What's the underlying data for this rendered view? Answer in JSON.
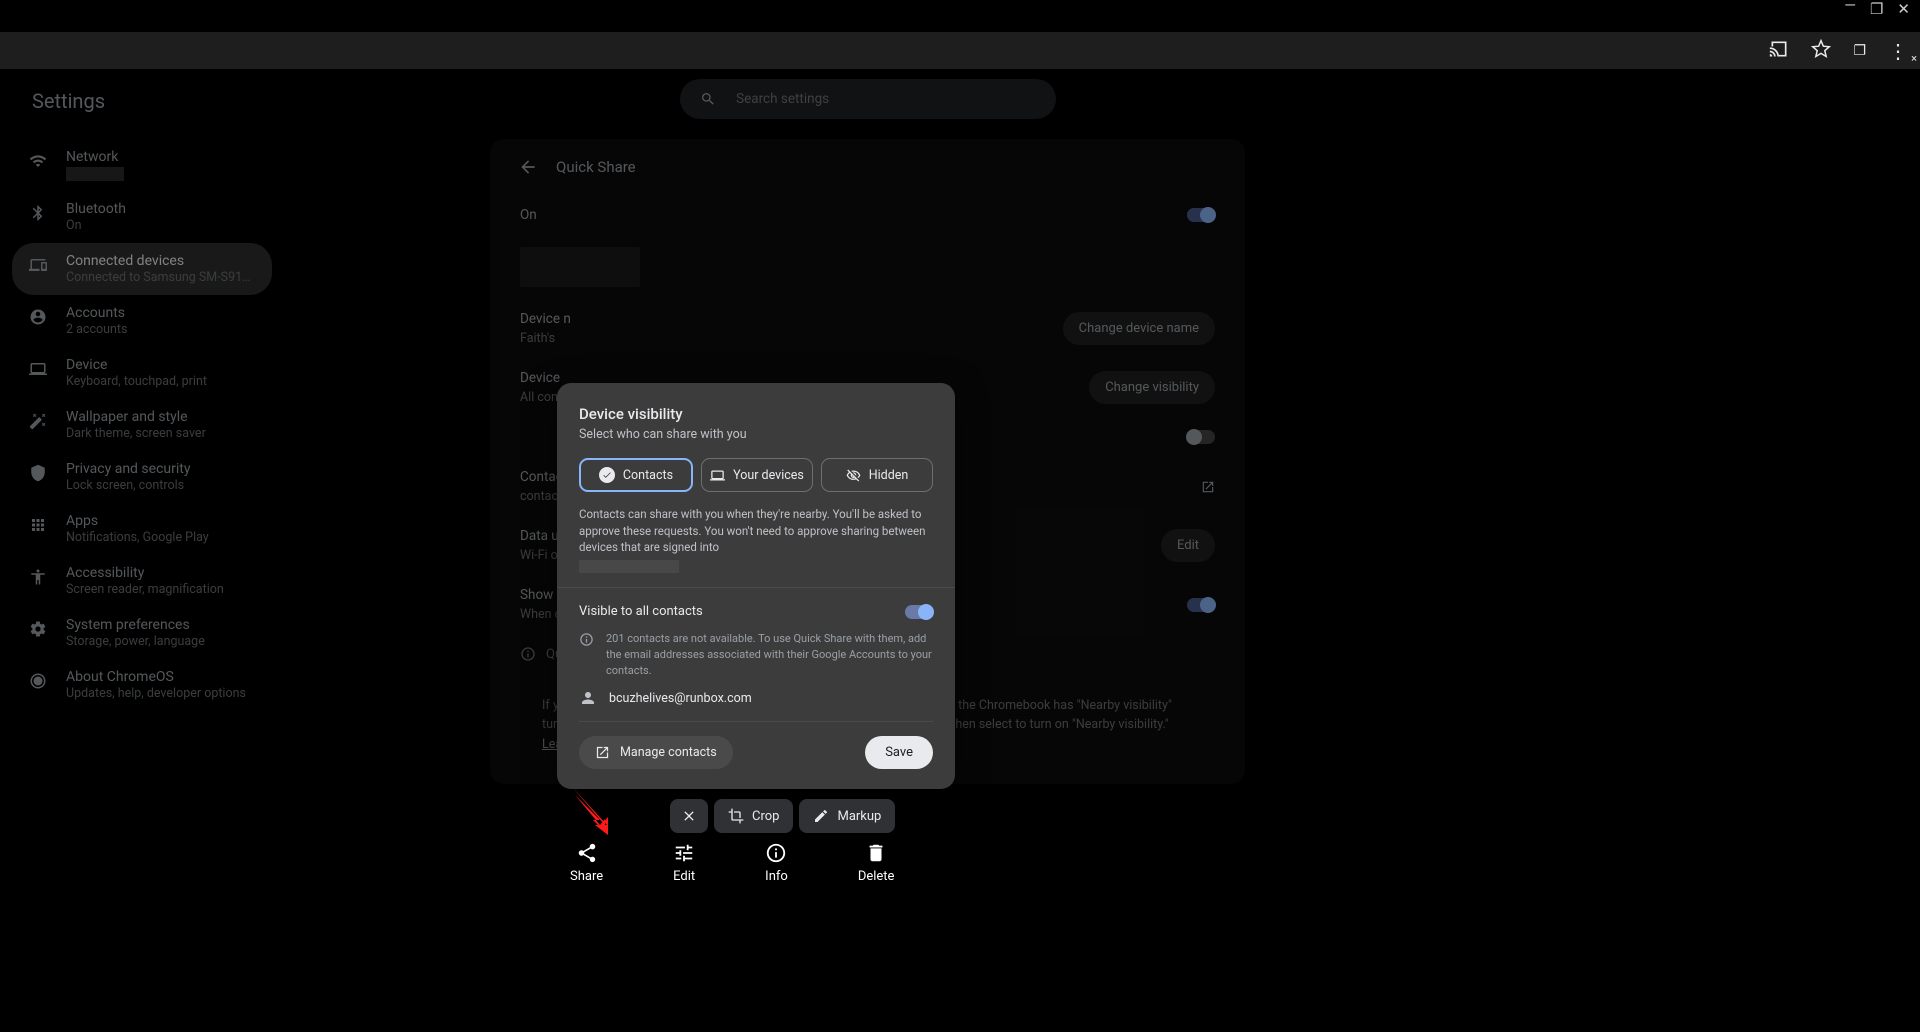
{
  "window_controls": {
    "minimize": "—",
    "maximize": "❐",
    "close": "✕"
  },
  "browser": {
    "back": "←"
  },
  "header": {
    "title": "Settings"
  },
  "search": {
    "placeholder": "Search settings"
  },
  "sidebar": [
    {
      "id": "network",
      "title": "Network",
      "sub": ""
    },
    {
      "id": "bluetooth",
      "title": "Bluetooth",
      "sub": "On"
    },
    {
      "id": "connected",
      "title": "Connected devices",
      "sub": "Connected to Samsung SM-S91…",
      "active": true
    },
    {
      "id": "accounts",
      "title": "Accounts",
      "sub": "2 accounts"
    },
    {
      "id": "device",
      "title": "Device",
      "sub": "Keyboard, touchpad, print"
    },
    {
      "id": "wallpaper",
      "title": "Wallpaper and style",
      "sub": "Dark theme, screen saver"
    },
    {
      "id": "privacy",
      "title": "Privacy and security",
      "sub": "Lock screen, controls"
    },
    {
      "id": "apps",
      "title": "Apps",
      "sub": "Notifications, Google Play"
    },
    {
      "id": "accessibility",
      "title": "Accessibility",
      "sub": "Screen reader, magnification"
    },
    {
      "id": "system",
      "title": "System preferences",
      "sub": "Storage, power, language"
    },
    {
      "id": "about",
      "title": "About ChromeOS",
      "sub": "Updates, help, developer options"
    }
  ],
  "panel": {
    "title": "Quick Share",
    "on_label": "On",
    "device_name_label": "Device n",
    "device_name_sub": "Faith's",
    "change_name": "Change device name",
    "visibility_label": "Device",
    "visibility_sub": "All cont",
    "change_visibility": "Change visibility",
    "contacts_label": "Contac",
    "contacts_sub": "contac",
    "data_label": "Data us",
    "data_sub": "Wi-Fi o",
    "edit": "Edit",
    "show_label": "Show n",
    "show_sub": "When c",
    "qu": "Qu",
    "hint_text": "If you're sharing with a Chromebook that is not in your contacts, make sure the Chromebook has \"Nearby visibility\" turned on. To turn on \"Nearby visibility,\" select the bottom right corner and then select to turn on \"Nearby visibility.\" ",
    "learn_more": "Learn more"
  },
  "modal": {
    "title": "Device visibility",
    "subtitle": "Select who can share with you",
    "opt_contacts": "Contacts",
    "opt_devices": "Your devices",
    "opt_hidden": "Hidden",
    "desc": "Contacts can share with you when they're nearby. You'll be asked to approve these requests. You won't need to approve sharing between devices that are signed into",
    "visible_all": "Visible to all contacts",
    "note": "201 contacts are not available. To use Quick Share with them, add the email addresses associated with their Google Accounts to your contacts.",
    "contact_email": "bcuzhelives@runbox.com",
    "manage": "Manage contacts",
    "save": "Save"
  },
  "shot_bar": {
    "crop": "Crop",
    "markup": "Markup"
  },
  "bottom": {
    "share": "Share",
    "edit": "Edit",
    "info": "Info",
    "delete": "Delete"
  }
}
